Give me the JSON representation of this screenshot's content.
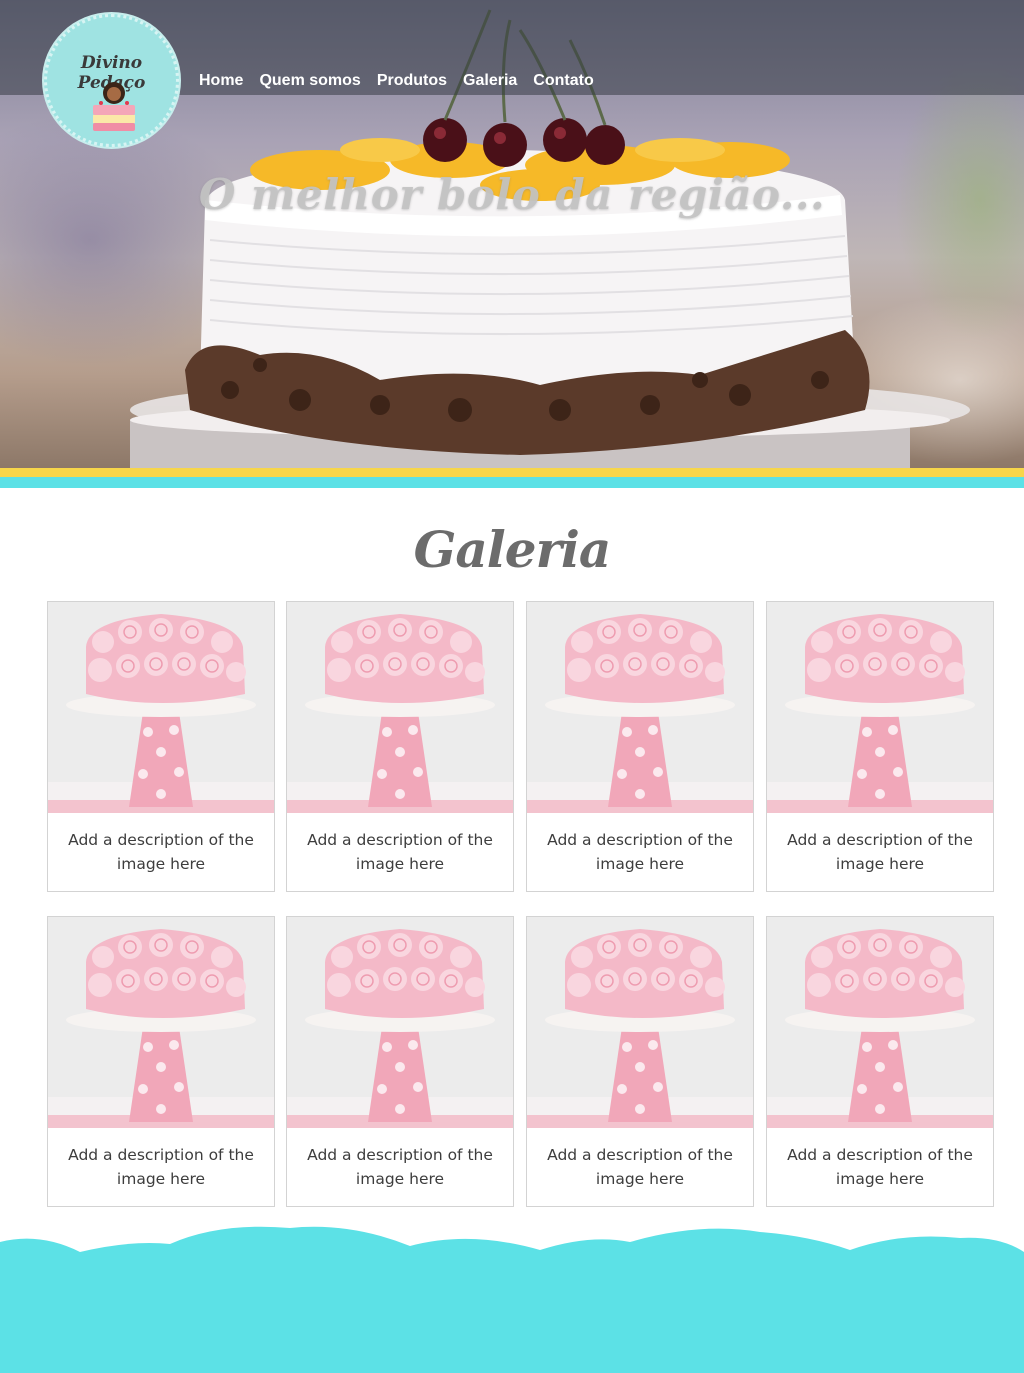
{
  "site": {
    "logo_text": "Divino Pedaço",
    "hero_title": "O melhor bolo da região..."
  },
  "nav": {
    "items": [
      {
        "label": "Home"
      },
      {
        "label": "Quem somos"
      },
      {
        "label": "Produtos"
      },
      {
        "label": "Galeria"
      },
      {
        "label": "Contato"
      }
    ]
  },
  "gallery": {
    "title": "Galeria",
    "cards": [
      {
        "description": "Add a description of the image here"
      },
      {
        "description": "Add a description of the image here"
      },
      {
        "description": "Add a description of the image here"
      },
      {
        "description": "Add a description of the image here"
      },
      {
        "description": "Add a description of the image here"
      },
      {
        "description": "Add a description of the image here"
      },
      {
        "description": "Add a description of the image here"
      },
      {
        "description": "Add a description of the image here"
      }
    ]
  },
  "colors": {
    "accent_cyan": "#5ce1e6",
    "accent_yellow": "#f7d64a",
    "logo_bg": "#9fe3e2"
  }
}
